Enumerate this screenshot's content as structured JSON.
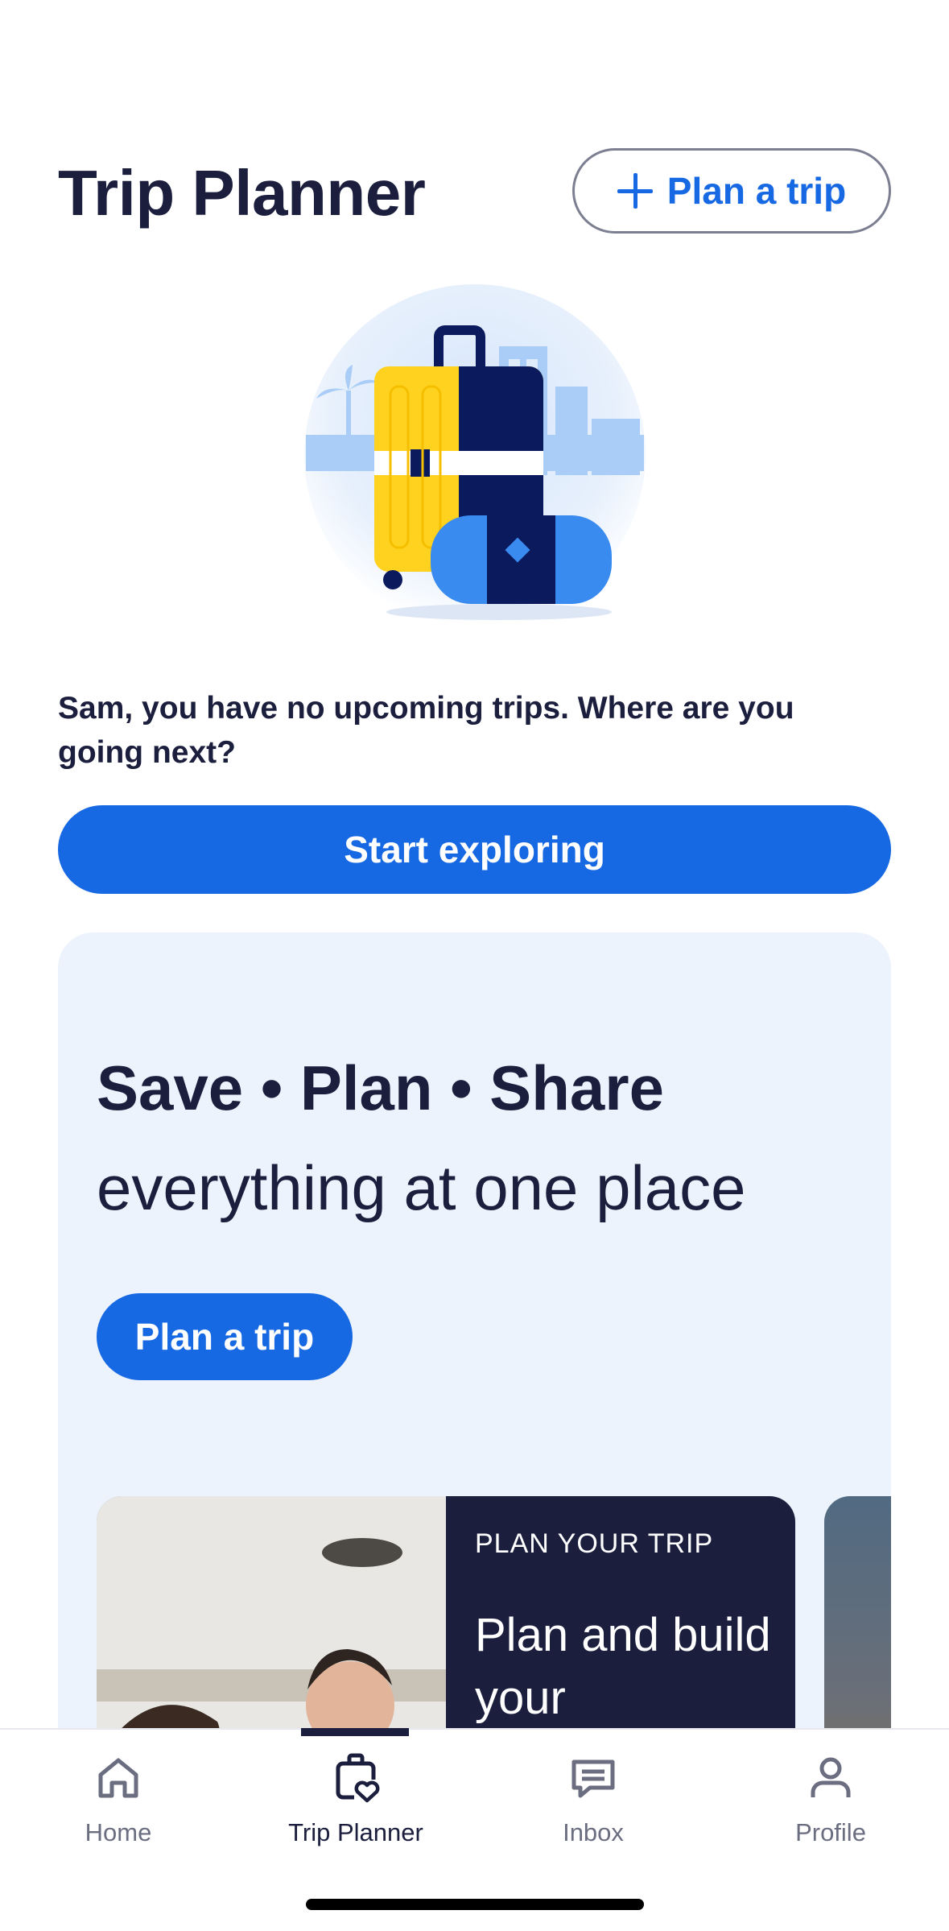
{
  "header": {
    "title": "Trip Planner",
    "plan_trip_label": "Plan a trip"
  },
  "hero": {
    "illustration": "luggage-illustration"
  },
  "empty_state": {
    "message": "Sam, you have no upcoming trips. Where are you going next?",
    "cta_label": "Start exploring"
  },
  "promo": {
    "headline": "Save • Plan • Share",
    "subheadline": "everything at one place",
    "cta_label": "Plan a trip",
    "card": {
      "eyebrow": "PLAN YOUR TRIP",
      "title": "Plan and build your"
    }
  },
  "tabbar": {
    "items": [
      {
        "label": "Home",
        "icon": "home-icon",
        "active": false
      },
      {
        "label": "Trip Planner",
        "icon": "trip-planner-icon",
        "active": true
      },
      {
        "label": "Inbox",
        "icon": "inbox-icon",
        "active": false
      },
      {
        "label": "Profile",
        "icon": "profile-icon",
        "active": false
      }
    ]
  },
  "colors": {
    "primary": "#1668e3",
    "ink": "#1b1e3d",
    "promo_bg": "#ecf3fc"
  }
}
